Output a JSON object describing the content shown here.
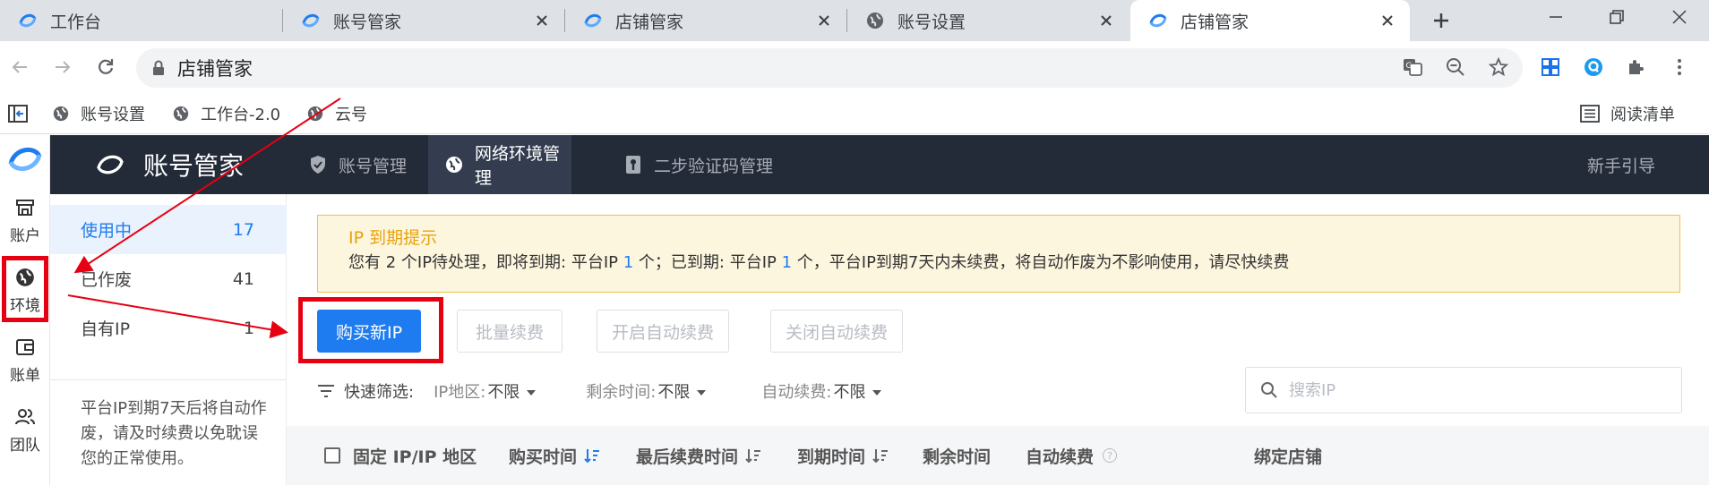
{
  "browser": {
    "tabs": [
      {
        "title": "工作台",
        "icon": "app-logo"
      },
      {
        "title": "账号管家",
        "icon": "app-logo"
      },
      {
        "title": "店铺管家",
        "icon": "app-logo"
      },
      {
        "title": "账号设置",
        "icon": "globe"
      },
      {
        "title": "店铺管家",
        "icon": "app-logo",
        "active": true
      }
    ],
    "address": "店铺管家",
    "bookmarks": [
      "账号设置",
      "工作台-2.0",
      "云号"
    ],
    "reading_list": "阅读清单"
  },
  "rail": {
    "items": [
      {
        "label": "账户",
        "icon": "store-icon"
      },
      {
        "label": "环境",
        "icon": "globe-icon"
      },
      {
        "label": "账单",
        "icon": "wallet-icon"
      },
      {
        "label": "团队",
        "icon": "team-icon"
      }
    ]
  },
  "header": {
    "brand": "账号管家",
    "menu": [
      {
        "label": "账号管理",
        "icon": "shield-icon"
      },
      {
        "label": "网络环境管理",
        "icon": "globe-icon",
        "active": true
      },
      {
        "label": "二步验证码管理",
        "icon": "key-icon"
      }
    ],
    "guide": "新手引导"
  },
  "sidebar": {
    "items": [
      {
        "label": "使用中",
        "count": "17",
        "active": true
      },
      {
        "label": "已作废",
        "count": "41"
      },
      {
        "label": "自有IP",
        "count": "1"
      }
    ],
    "note": "平台IP到期7天后将自动作废，请及时续费以免耽误您的正常使用。"
  },
  "alert": {
    "title": "IP 到期提示",
    "d1": "您有 2 个IP待处理，即将到期: 平台IP ",
    "n1": "1",
    "d2": " 个；已到期: 平台IP ",
    "n2": "1",
    "d3": " 个，平台IP到期7天内未续费，将自动作废为不影响使用，请尽快续费"
  },
  "actions": {
    "buy": "购买新IP",
    "batch_renew": "批量续费",
    "enable_auto": "开启自动续费",
    "disable_auto": "关闭自动续费"
  },
  "filters": {
    "label": "快速筛选:",
    "region_label": "IP地区:",
    "region_value": "不限",
    "remain_label": "剩余时间:",
    "remain_value": "不限",
    "auto_label": "自动续费:",
    "auto_value": "不限",
    "search_placeholder": "搜索IP"
  },
  "table": {
    "columns": [
      "固定 IP/IP 地区",
      "购买时间",
      "最后续费时间",
      "到期时间",
      "剩余时间",
      "自动续费",
      "绑定店铺"
    ]
  },
  "colors": {
    "accent": "#1f7cf0",
    "header_bg": "#232a38",
    "annotation": "#e60012",
    "alert_bg": "#fdf6de"
  }
}
